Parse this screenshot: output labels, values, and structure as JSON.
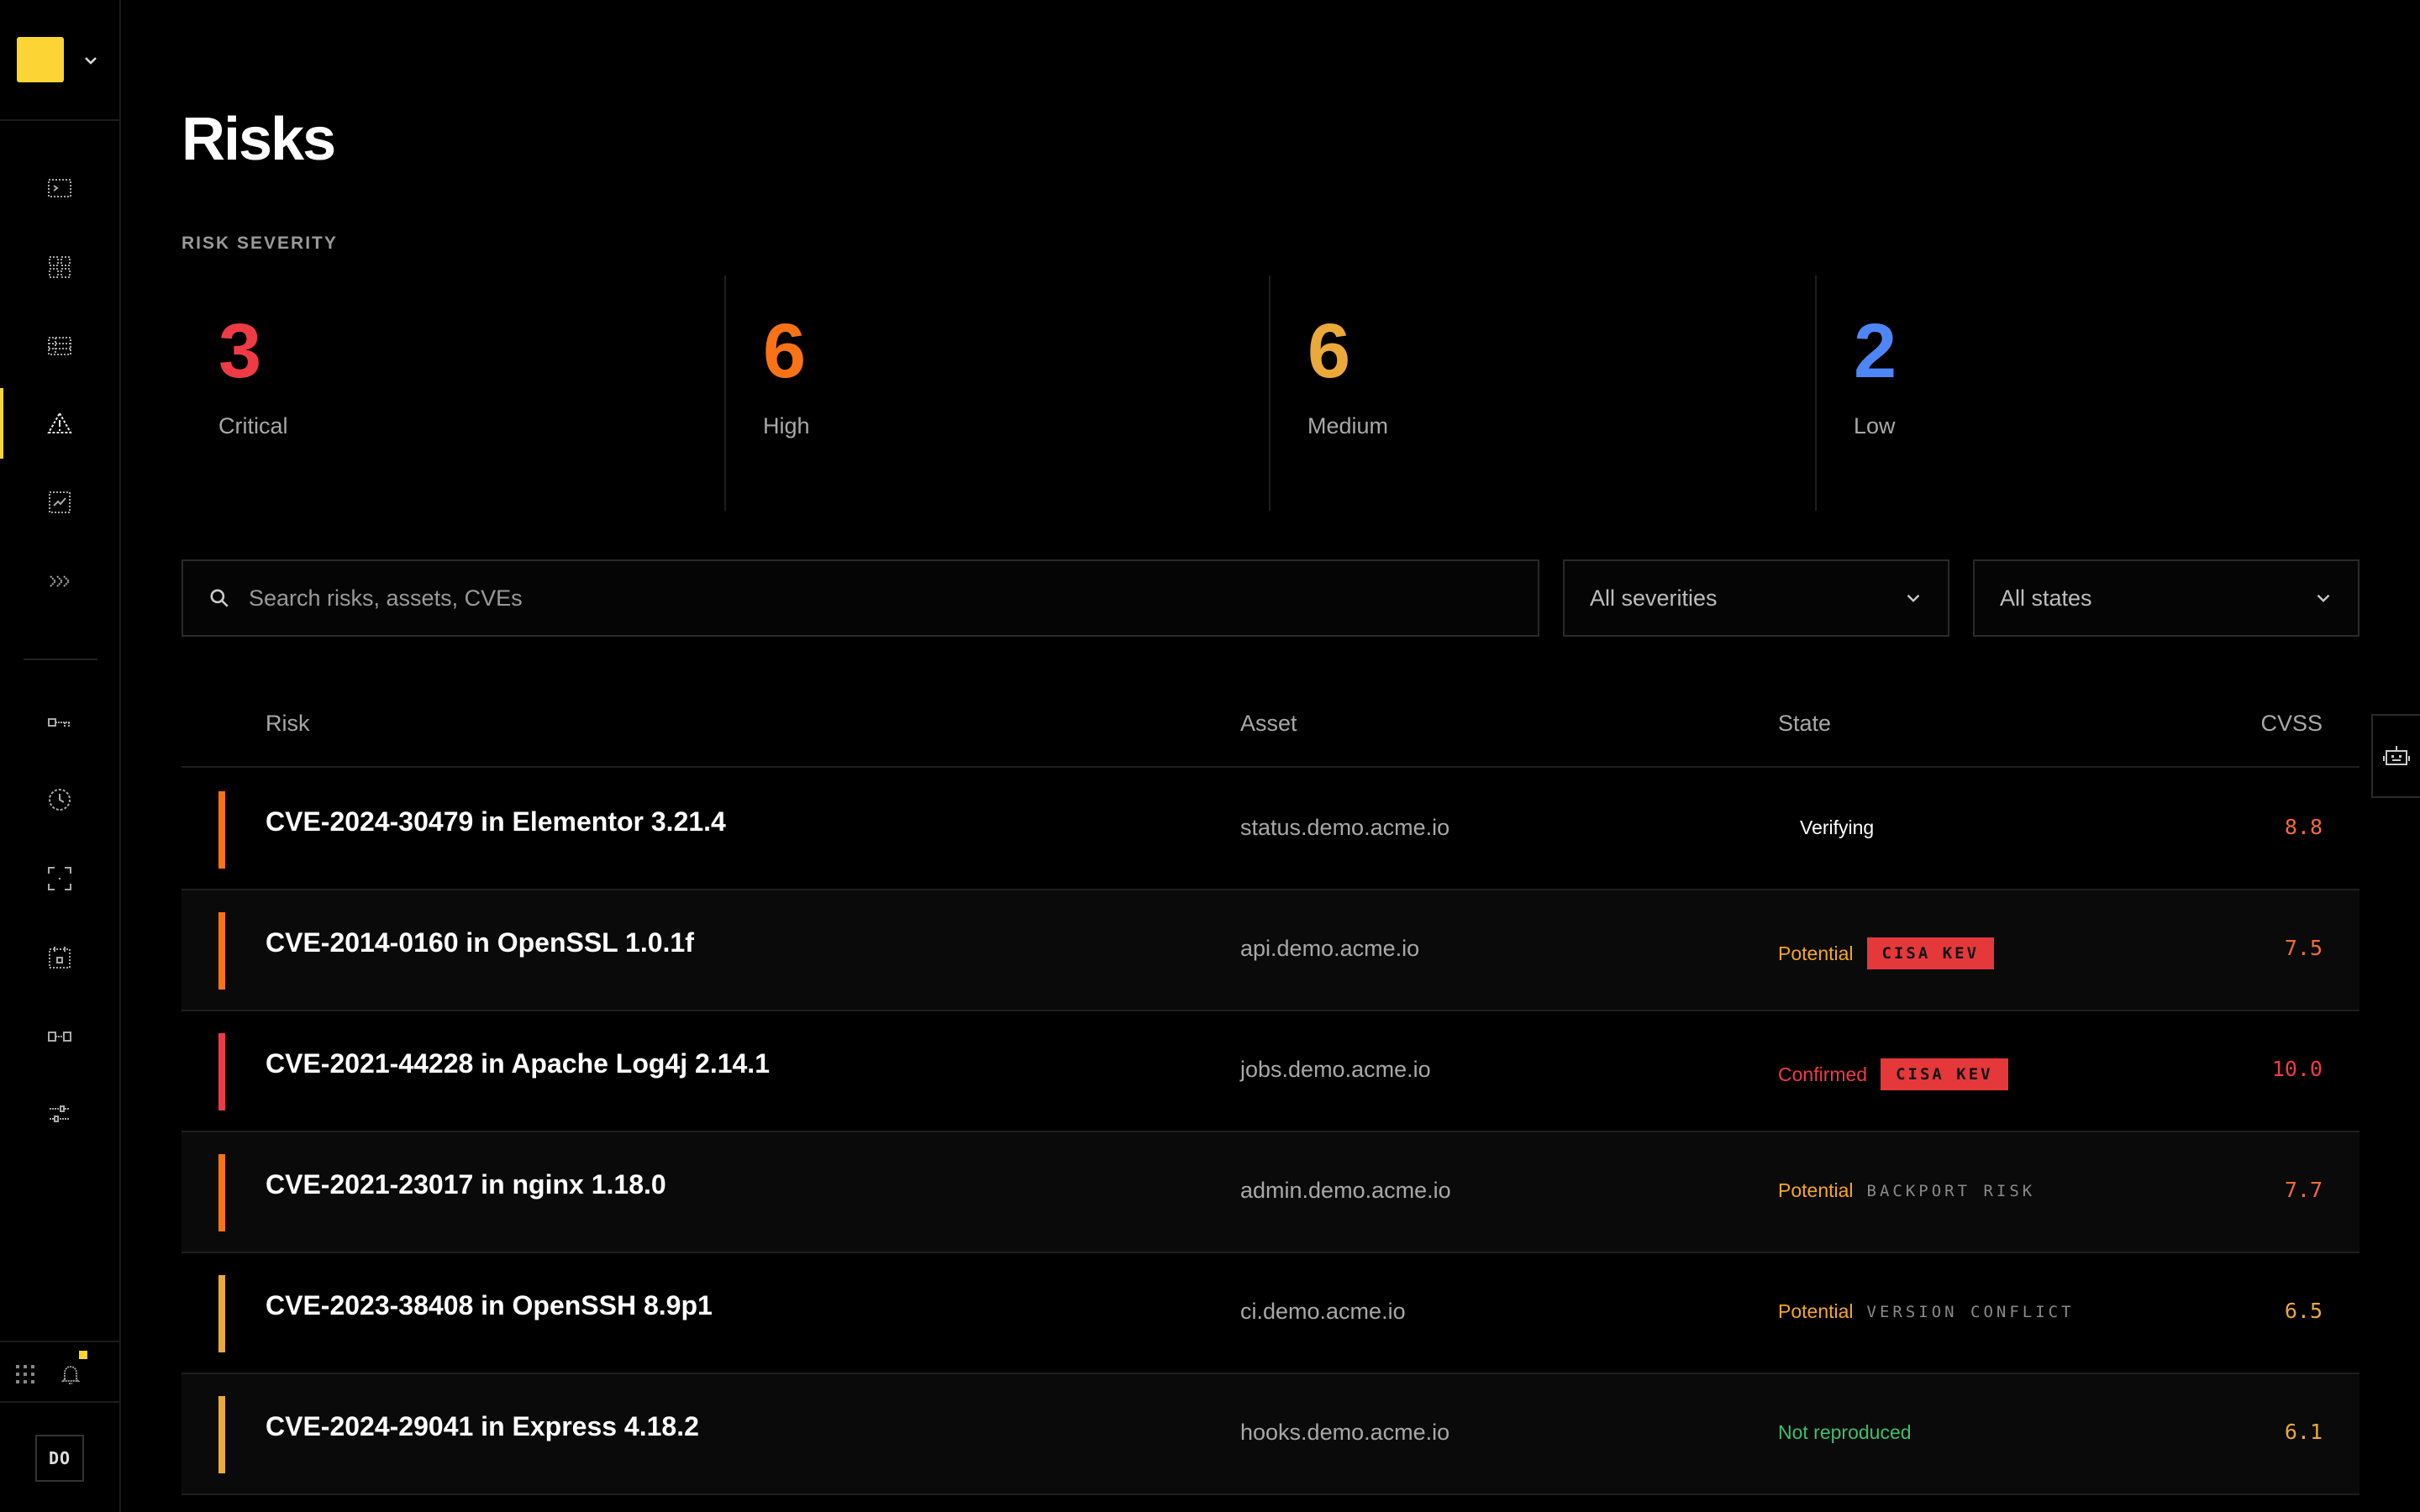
{
  "page": {
    "title": "Risks"
  },
  "severity": {
    "label": "RISK SEVERITY",
    "cards": [
      {
        "count": "3",
        "label": "Critical",
        "color": "#ef3b45"
      },
      {
        "count": "6",
        "label": "High",
        "color": "#f97316"
      },
      {
        "count": "6",
        "label": "Medium",
        "color": "#eaa93a"
      },
      {
        "count": "2",
        "label": "Low",
        "color": "#4f86f7"
      }
    ]
  },
  "filters": {
    "search_placeholder": "Search risks, assets, CVEs",
    "severity_select": "All severities",
    "state_select": "All states"
  },
  "table": {
    "columns": {
      "risk": "Risk",
      "asset": "Asset",
      "state": "State",
      "cvss": "CVSS"
    },
    "rows": [
      {
        "risk": "CVE-2024-30479 in Elementor 3.21.4",
        "asset": "status.demo.acme.io",
        "state": "Verifying",
        "state_color": "#ffffff",
        "tag": "",
        "tag_kind": "none",
        "cvss": "8.8",
        "cvss_color": "#f26b3a",
        "bar_color": "#f97316"
      },
      {
        "risk": "CVE-2014-0160 in OpenSSL 1.0.1f",
        "asset": "api.demo.acme.io",
        "state": "Potential",
        "state_color": "#f5a623",
        "tag": "CISA KEV",
        "tag_kind": "kev",
        "cvss": "7.5",
        "cvss_color": "#f26b3a",
        "bar_color": "#f97316"
      },
      {
        "risk": "CVE-2021-44228 in Apache Log4j 2.14.1",
        "asset": "jobs.demo.acme.io",
        "state": "Confirmed",
        "state_color": "#ef3b45",
        "tag": "CISA KEV",
        "tag_kind": "kev",
        "cvss": "10.0",
        "cvss_color": "#ef3b45",
        "bar_color": "#ef3b45"
      },
      {
        "risk": "CVE-2021-23017 in nginx 1.18.0",
        "asset": "admin.demo.acme.io",
        "state": "Potential",
        "state_color": "#f5a623",
        "tag": "BACKPORT RISK",
        "tag_kind": "plain",
        "cvss": "7.7",
        "cvss_color": "#f26b3a",
        "bar_color": "#f97316"
      },
      {
        "risk": "CVE-2023-38408 in OpenSSH 8.9p1",
        "asset": "ci.demo.acme.io",
        "state": "Potential",
        "state_color": "#f5a623",
        "tag": "VERSION CONFLICT",
        "tag_kind": "plain",
        "cvss": "6.5",
        "cvss_color": "#eaa93a",
        "bar_color": "#eaa93a"
      },
      {
        "risk": "CVE-2024-29041 in Express 4.18.2",
        "asset": "hooks.demo.acme.io",
        "state": "Not reproduced",
        "state_color": "#3fbf6a",
        "tag": "",
        "tag_kind": "none",
        "cvss": "6.1",
        "cvss_color": "#eaa93a",
        "bar_color": "#eaa93a"
      }
    ]
  },
  "user": {
    "initials": "DO"
  },
  "colors": {
    "accent": "#fcd535",
    "background": "#000000",
    "border": "#1e1e1e"
  }
}
